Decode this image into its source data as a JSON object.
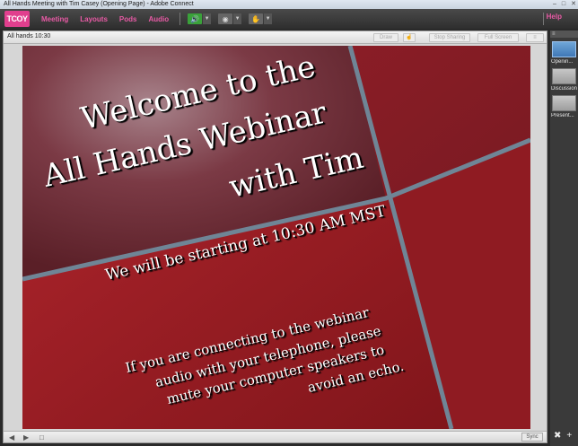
{
  "window": {
    "title": "All Hands Meeting with Tim Casey (Opening Page) - Adobe Connect",
    "controls": [
      "–",
      "□",
      "✕"
    ]
  },
  "menubar": {
    "logo_text": "TCOY",
    "items": [
      "Meeting",
      "Layouts",
      "Pods",
      "Audio"
    ],
    "help": "Help"
  },
  "pod": {
    "title": "All hands 10:30",
    "buttons": [
      "Draw",
      "Stop Sharing",
      "Full Screen"
    ],
    "sync_label": "Sync"
  },
  "slide": {
    "heading_lines": [
      "Welcome to the",
      "All Hands Webinar",
      "with Tim"
    ],
    "subheading": "We will be starting at 10:30 AM MST",
    "body_lines": [
      "If you are connecting to the webinar",
      "audio with your telephone, please",
      "mute your computer speakers to",
      "avoid an echo."
    ]
  },
  "layouts_rail": {
    "items": [
      "Openin...",
      "Discussion",
      "Present..."
    ]
  },
  "colors": {
    "accent": "#e85aa5",
    "slide_red": "#8e1d24",
    "stripe": "#6f8596",
    "active_thumb": "#3f78b6"
  }
}
